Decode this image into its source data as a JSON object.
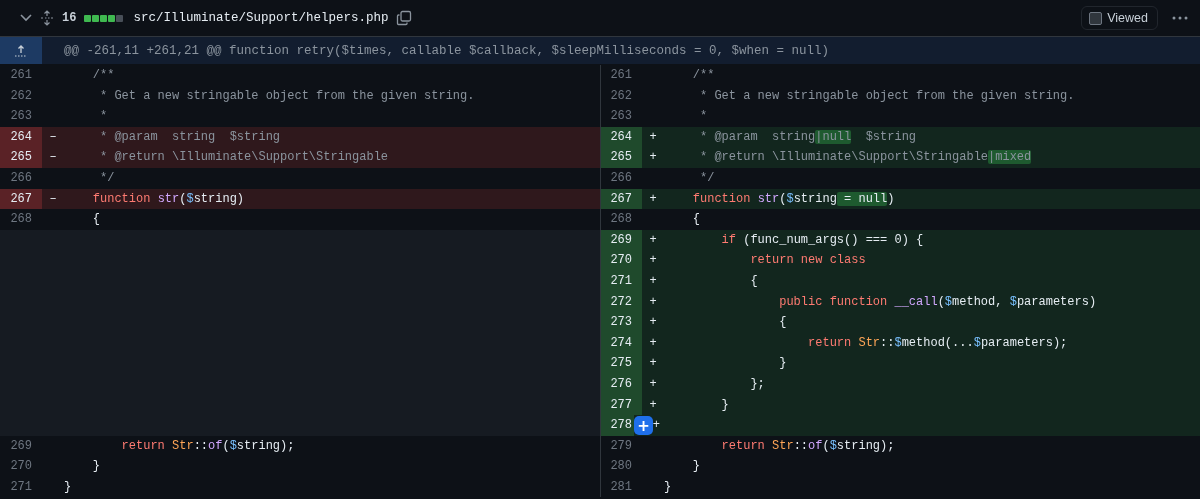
{
  "file_header": {
    "changes": "16",
    "diffstat": [
      {
        "kind": "added"
      },
      {
        "kind": "added"
      },
      {
        "kind": "added"
      },
      {
        "kind": "added"
      },
      {
        "kind": "neutral"
      }
    ],
    "path": "src/Illuminate/Support/helpers.php",
    "viewed": {
      "label": "Viewed",
      "checked": false
    }
  },
  "hunk": {
    "header": "@@ -261,11 +261,21 @@ function retry($times, callable $callback, $sleepMilliseconds = 0, $when = null)"
  },
  "rows": [
    {
      "left": {
        "kind": "context",
        "number": "261",
        "tokens": [
          {
            "kind": "comment",
            "text": "    /**"
          }
        ]
      },
      "right": {
        "kind": "context",
        "number": "261",
        "tokens": [
          {
            "kind": "comment",
            "text": "    /**"
          }
        ]
      }
    },
    {
      "left": {
        "kind": "context",
        "number": "262",
        "tokens": [
          {
            "kind": "comment",
            "text": "     * Get a new stringable object from the given string."
          }
        ]
      },
      "right": {
        "kind": "context",
        "number": "262",
        "tokens": [
          {
            "kind": "comment",
            "text": "     * Get a new stringable object from the given string."
          }
        ]
      }
    },
    {
      "left": {
        "kind": "context",
        "number": "263",
        "tokens": [
          {
            "kind": "comment",
            "text": "     *"
          }
        ]
      },
      "right": {
        "kind": "context",
        "number": "263",
        "tokens": [
          {
            "kind": "comment",
            "text": "     *"
          }
        ]
      }
    },
    {
      "left": {
        "kind": "deletion",
        "number": "264",
        "sign": "–",
        "tokens": [
          {
            "kind": "comment",
            "text": "     * @param  string  $string"
          }
        ]
      },
      "right": {
        "kind": "addition",
        "number": "264",
        "sign": "+",
        "tokens": [
          {
            "kind": "comment",
            "text": "     * @param  string"
          },
          {
            "kind": "marked-comment",
            "text": "|null"
          },
          {
            "kind": "comment",
            "text": "  $string"
          }
        ]
      }
    },
    {
      "left": {
        "kind": "deletion",
        "number": "265",
        "sign": "–",
        "tokens": [
          {
            "kind": "comment",
            "text": "     * @return \\Illuminate\\Support\\Stringable"
          }
        ]
      },
      "right": {
        "kind": "addition",
        "number": "265",
        "sign": "+",
        "tokens": [
          {
            "kind": "comment",
            "text": "     * @return \\Illuminate\\Support\\Stringable"
          },
          {
            "kind": "marked-comment",
            "text": "|mixed"
          }
        ]
      }
    },
    {
      "left": {
        "kind": "context",
        "number": "266",
        "tokens": [
          {
            "kind": "comment",
            "text": "     */"
          }
        ]
      },
      "right": {
        "kind": "context",
        "number": "266",
        "tokens": [
          {
            "kind": "comment",
            "text": "     */"
          }
        ]
      }
    },
    {
      "left": {
        "kind": "deletion",
        "number": "267",
        "sign": "–",
        "tokens": [
          {
            "kind": "keyword",
            "text": "    function "
          },
          {
            "kind": "entity",
            "text": "str"
          },
          {
            "kind": "plain",
            "text": "("
          },
          {
            "kind": "constant",
            "text": "$"
          },
          {
            "kind": "plain",
            "text": "string)"
          }
        ]
      },
      "right": {
        "kind": "addition",
        "number": "267",
        "sign": "+",
        "tokens": [
          {
            "kind": "keyword",
            "text": "    function "
          },
          {
            "kind": "entity",
            "text": "str"
          },
          {
            "kind": "plain",
            "text": "("
          },
          {
            "kind": "constant",
            "text": "$"
          },
          {
            "kind": "plain",
            "text": "string"
          },
          {
            "kind": "marked-plain",
            "text": " = null"
          },
          {
            "kind": "plain",
            "text": ")"
          }
        ]
      }
    },
    {
      "left": {
        "kind": "context",
        "number": "268",
        "tokens": [
          {
            "kind": "plain",
            "text": "    {"
          }
        ]
      },
      "right": {
        "kind": "context",
        "number": "268",
        "tokens": [
          {
            "kind": "plain",
            "text": "    {"
          }
        ]
      }
    },
    {
      "left": {
        "kind": "empty"
      },
      "right": {
        "kind": "addition",
        "number": "269",
        "sign": "+",
        "tokens": [
          {
            "kind": "keyword",
            "text": "        if"
          },
          {
            "kind": "plain",
            "text": " (func_num_args() === 0) {"
          }
        ]
      }
    },
    {
      "left": {
        "kind": "empty"
      },
      "right": {
        "kind": "addition",
        "number": "270",
        "sign": "+",
        "tokens": [
          {
            "kind": "keyword",
            "text": "            return new class"
          }
        ]
      }
    },
    {
      "left": {
        "kind": "empty"
      },
      "right": {
        "kind": "addition",
        "number": "271",
        "sign": "+",
        "tokens": [
          {
            "kind": "plain",
            "text": "            {"
          }
        ]
      }
    },
    {
      "left": {
        "kind": "empty"
      },
      "right": {
        "kind": "addition",
        "number": "272",
        "sign": "+",
        "tokens": [
          {
            "kind": "keyword",
            "text": "                public function "
          },
          {
            "kind": "entity",
            "text": "__call"
          },
          {
            "kind": "plain",
            "text": "("
          },
          {
            "kind": "constant",
            "text": "$"
          },
          {
            "kind": "plain",
            "text": "method, "
          },
          {
            "kind": "constant",
            "text": "$"
          },
          {
            "kind": "plain",
            "text": "parameters)"
          }
        ]
      }
    },
    {
      "left": {
        "kind": "empty"
      },
      "right": {
        "kind": "addition",
        "number": "273",
        "sign": "+",
        "tokens": [
          {
            "kind": "plain",
            "text": "                {"
          }
        ]
      }
    },
    {
      "left": {
        "kind": "empty"
      },
      "right": {
        "kind": "addition",
        "number": "274",
        "sign": "+",
        "tokens": [
          {
            "kind": "keyword",
            "text": "                    return "
          },
          {
            "kind": "class",
            "text": "Str"
          },
          {
            "kind": "plain",
            "text": "::"
          },
          {
            "kind": "constant",
            "text": "$"
          },
          {
            "kind": "plain",
            "text": "method(..."
          },
          {
            "kind": "constant",
            "text": "$"
          },
          {
            "kind": "plain",
            "text": "parameters);"
          }
        ]
      }
    },
    {
      "left": {
        "kind": "empty"
      },
      "right": {
        "kind": "addition",
        "number": "275",
        "sign": "+",
        "tokens": [
          {
            "kind": "plain",
            "text": "                }"
          }
        ]
      }
    },
    {
      "left": {
        "kind": "empty"
      },
      "right": {
        "kind": "addition",
        "number": "276",
        "sign": "+",
        "tokens": [
          {
            "kind": "plain",
            "text": "            };"
          }
        ]
      }
    },
    {
      "left": {
        "kind": "empty"
      },
      "right": {
        "kind": "addition",
        "number": "277",
        "sign": "+",
        "tokens": [
          {
            "kind": "plain",
            "text": "        }"
          }
        ]
      }
    },
    {
      "left": {
        "kind": "empty"
      },
      "right": {
        "kind": "addition",
        "number": "278",
        "sign": "+",
        "comment_button": "+"
      }
    },
    {
      "left": {
        "kind": "context",
        "number": "269",
        "tokens": [
          {
            "kind": "keyword",
            "text": "        return "
          },
          {
            "kind": "class",
            "text": "Str"
          },
          {
            "kind": "plain",
            "text": "::"
          },
          {
            "kind": "entity",
            "text": "of"
          },
          {
            "kind": "plain",
            "text": "("
          },
          {
            "kind": "constant",
            "text": "$"
          },
          {
            "kind": "plain",
            "text": "string);"
          }
        ]
      },
      "right": {
        "kind": "context",
        "number": "279",
        "tokens": [
          {
            "kind": "keyword",
            "text": "        return "
          },
          {
            "kind": "class",
            "text": "Str"
          },
          {
            "kind": "plain",
            "text": "::"
          },
          {
            "kind": "entity",
            "text": "of"
          },
          {
            "kind": "plain",
            "text": "("
          },
          {
            "kind": "constant",
            "text": "$"
          },
          {
            "kind": "plain",
            "text": "string);"
          }
        ]
      }
    },
    {
      "left": {
        "kind": "context",
        "number": "270",
        "tokens": [
          {
            "kind": "plain",
            "text": "    }"
          }
        ]
      },
      "right": {
        "kind": "context",
        "number": "280",
        "tokens": [
          {
            "kind": "plain",
            "text": "    }"
          }
        ]
      }
    },
    {
      "left": {
        "kind": "context",
        "number": "271",
        "tokens": [
          {
            "kind": "plain",
            "text": "}"
          }
        ]
      },
      "right": {
        "kind": "context",
        "number": "281",
        "tokens": [
          {
            "kind": "plain",
            "text": "}"
          }
        ]
      }
    }
  ]
}
